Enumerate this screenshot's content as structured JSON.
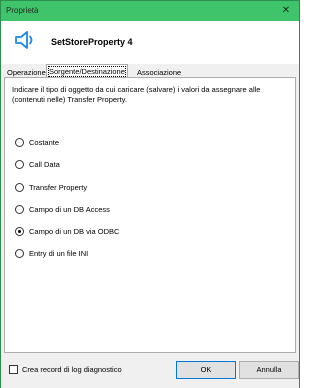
{
  "window": {
    "title": "Proprietà",
    "close_symbol": "✕"
  },
  "header": {
    "icon": "speaker-icon",
    "name": "SetStoreProperty 4"
  },
  "tabs": [
    {
      "label": "Operazione"
    },
    {
      "label": "Sorgente/Destinazione"
    },
    {
      "label": "Associazione"
    }
  ],
  "panel": {
    "description": "Indicare il tipo di oggetto da cui caricare (salvare) i valori da assegnare alle (contenuti nelle) Transfer Property.",
    "options": [
      {
        "label": "Costante",
        "checked": false
      },
      {
        "label": "Call Data",
        "checked": false
      },
      {
        "label": "Transfer Property",
        "checked": false
      },
      {
        "label": "Campo di un DB Access",
        "checked": false
      },
      {
        "label": "Campo di un DB via ODBC",
        "checked": true
      },
      {
        "label": "Entry di un file INI",
        "checked": false
      }
    ]
  },
  "footer": {
    "checkbox_label": "Crea record di log diagnostico",
    "checkbox_checked": false,
    "ok_label": "OK",
    "cancel_label": "Annulla"
  },
  "colors": {
    "titlebar": "#3fc46b",
    "speaker": "#1e88e5"
  }
}
